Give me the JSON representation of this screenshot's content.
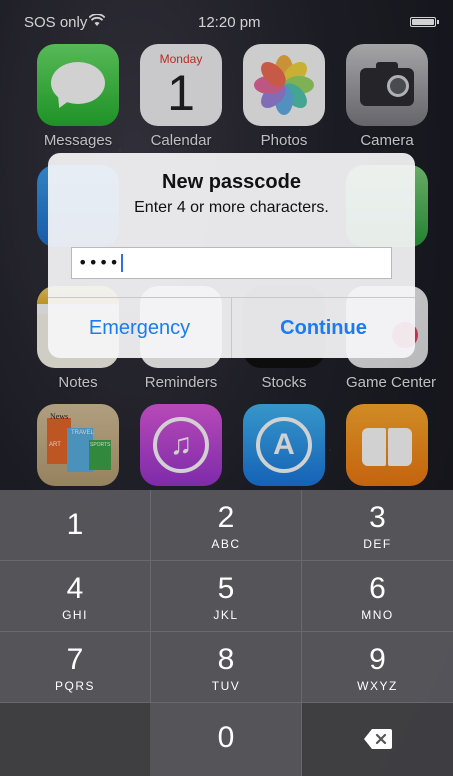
{
  "status_bar": {
    "carrier": "SOS only",
    "wifi_icon": "wifi-icon",
    "time": "12:20 pm",
    "battery_icon": "battery-full-icon"
  },
  "home_screen": {
    "apps_row1": [
      {
        "label": "Messages",
        "icon": "messages-icon"
      },
      {
        "label": "Calendar",
        "icon": "calendar-icon",
        "day": "Monday",
        "date": "1"
      },
      {
        "label": "Photos",
        "icon": "photos-icon"
      },
      {
        "label": "Camera",
        "icon": "camera-icon"
      }
    ],
    "apps_row3": [
      {
        "label": "Notes",
        "icon": "notes-icon"
      },
      {
        "label": "Reminders",
        "icon": "reminders-icon"
      },
      {
        "label": "Stocks",
        "icon": "stocks-icon"
      },
      {
        "label": "Game Center",
        "icon": "game-center-icon"
      }
    ],
    "apps_row4": [
      {
        "label": "Newsstand",
        "icon": "newsstand-icon",
        "magazines": [
          "News",
          "TRAVEL",
          "ART",
          "SPORTS"
        ]
      },
      {
        "label": "iTunes Store",
        "icon": "itunes-store-icon",
        "glyph": "♫"
      },
      {
        "label": "App Store",
        "icon": "app-store-icon",
        "glyph": "A"
      },
      {
        "label": "iBooks",
        "icon": "ibooks-icon"
      }
    ]
  },
  "alert": {
    "title": "New passcode",
    "message": "Enter 4 or more characters.",
    "passcode_value": "••••",
    "emergency_label": "Emergency",
    "continue_label": "Continue"
  },
  "keypad": {
    "keys": [
      {
        "digit": "1",
        "letters": ""
      },
      {
        "digit": "2",
        "letters": "ABC"
      },
      {
        "digit": "3",
        "letters": "DEF"
      },
      {
        "digit": "4",
        "letters": "GHI"
      },
      {
        "digit": "5",
        "letters": "JKL"
      },
      {
        "digit": "6",
        "letters": "MNO"
      },
      {
        "digit": "7",
        "letters": "PQRS"
      },
      {
        "digit": "8",
        "letters": "TUV"
      },
      {
        "digit": "9",
        "letters": "WXYZ"
      },
      {
        "digit": "0",
        "letters": ""
      }
    ],
    "delete_icon": "delete-backspace-icon"
  }
}
